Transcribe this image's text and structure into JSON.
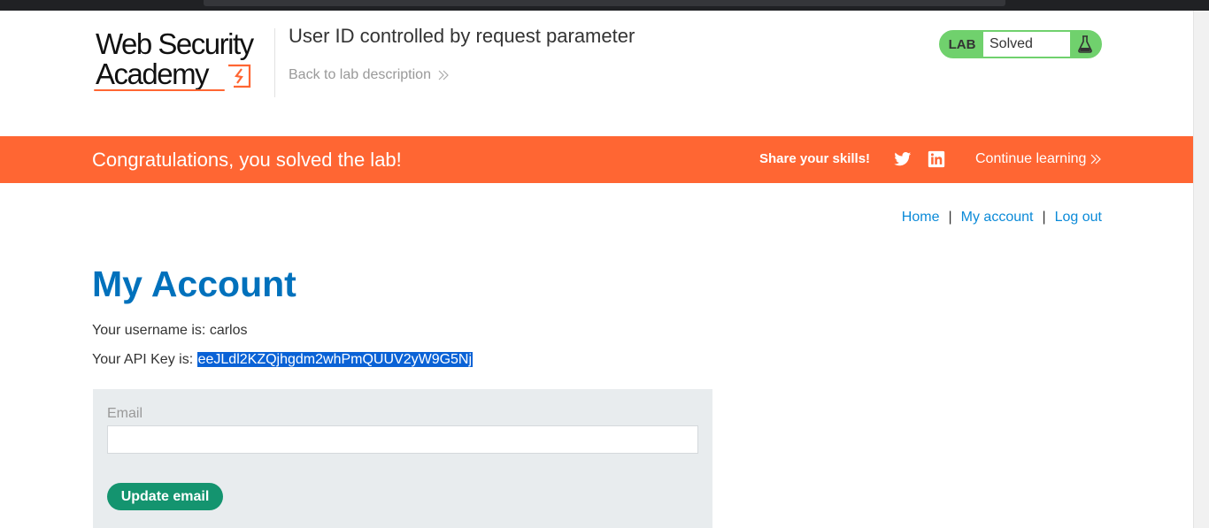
{
  "browser": {
    "chrome": "dark-top-strip"
  },
  "header": {
    "logo_line1": "Web Security",
    "logo_line2": "Academy",
    "lab_title": "User ID controlled by request parameter",
    "back_link": "Back to lab description",
    "lab_status": {
      "tag": "LAB",
      "status": "Solved",
      "icon": "flask-icon",
      "color": "#70d16d"
    }
  },
  "banner": {
    "message": "Congratulations, you solved the lab!",
    "share_label": "Share your skills!",
    "icons": [
      "twitter-icon",
      "linkedin-icon"
    ],
    "continue_label": "Continue learning",
    "color": "#ff6633"
  },
  "nav": {
    "home": "Home",
    "separator": "|",
    "my_account": "My account",
    "log_out": "Log out"
  },
  "main": {
    "title": "My Account",
    "username_prefix": "Your username is: carlos",
    "api_prefix": "Your API Key is: ",
    "api_key": "eeJLdl2KZQjhgdm2whPmQUUV2yW9G5Nj",
    "form": {
      "email_label": "Email",
      "email_value": "",
      "update_button": "Update email"
    }
  },
  "colors": {
    "link": "#0b8ad8",
    "title": "#0071bc",
    "button": "#14946f",
    "selection": "#0a62d6"
  }
}
